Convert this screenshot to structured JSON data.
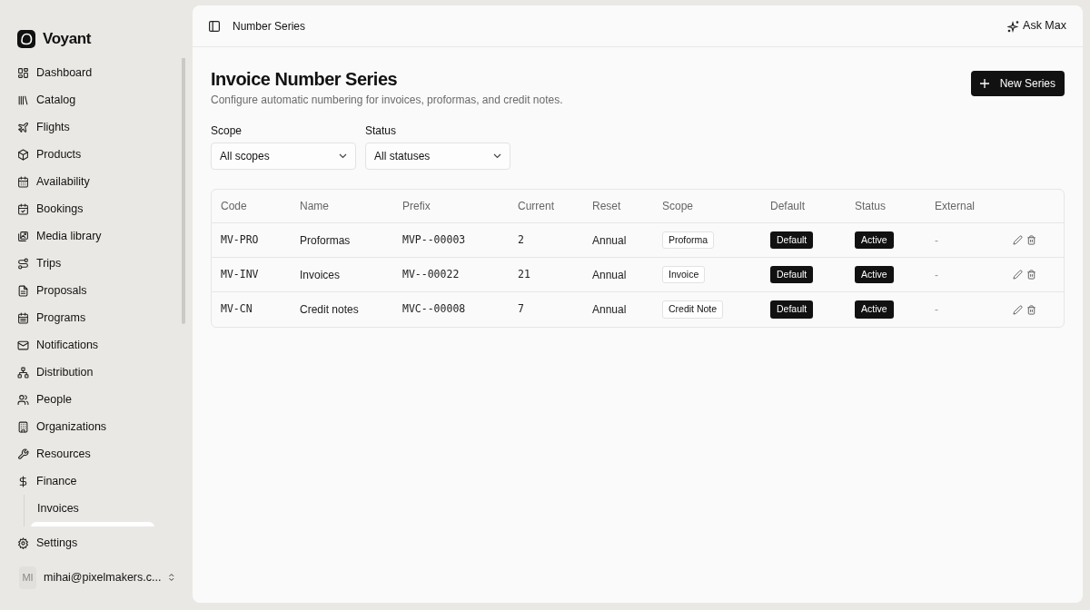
{
  "brand": "Voyant",
  "sidebar": {
    "items": [
      {
        "label": "Dashboard",
        "selected": false
      },
      {
        "label": "Catalog",
        "selected": false
      },
      {
        "label": "Flights",
        "selected": false
      },
      {
        "label": "Products",
        "selected": false
      },
      {
        "label": "Availability",
        "selected": false
      },
      {
        "label": "Bookings",
        "selected": false
      },
      {
        "label": "Media library",
        "selected": false
      },
      {
        "label": "Trips",
        "selected": false
      },
      {
        "label": "Proposals",
        "selected": false
      },
      {
        "label": "Programs",
        "selected": false
      },
      {
        "label": "Notifications",
        "selected": false
      },
      {
        "label": "Distribution",
        "selected": false
      },
      {
        "label": "People",
        "selected": false
      },
      {
        "label": "Organizations",
        "selected": false
      },
      {
        "label": "Resources",
        "selected": false
      },
      {
        "label": "Finance",
        "selected": false,
        "expanded": true,
        "children": [
          {
            "label": "Invoices",
            "selected": false
          }
        ]
      }
    ],
    "settings": "Settings",
    "user": {
      "initials": "MI",
      "email": "mihai@pixelmakers.c..."
    }
  },
  "header": {
    "breadcrumb": "Number Series",
    "ask": "Ask Max"
  },
  "page": {
    "title": "Invoice Number Series",
    "subtitle": "Configure automatic numbering for invoices, proformas, and credit notes.",
    "new_button": "New Series"
  },
  "filters": [
    {
      "label": "Scope",
      "value": "All scopes"
    },
    {
      "label": "Status",
      "value": "All statuses"
    }
  ],
  "table": {
    "columns": [
      "Code",
      "Name",
      "Prefix",
      "Current",
      "Reset",
      "Scope",
      "Default",
      "Status",
      "External"
    ],
    "rows": [
      {
        "code": "MV-PRO",
        "name": "Proformas",
        "prefix": "MVP--00003",
        "current": "2",
        "reset": "Annual",
        "scope": "Proforma",
        "default": "Default",
        "status": "Active",
        "external": "-"
      },
      {
        "code": "MV-INV",
        "name": "Invoices",
        "prefix": "MV--00022",
        "current": "21",
        "reset": "Annual",
        "scope": "Invoice",
        "default": "Default",
        "status": "Active",
        "external": "-"
      },
      {
        "code": "MV-CN",
        "name": "Credit notes",
        "prefix": "MVC--00008",
        "current": "7",
        "reset": "Annual",
        "scope": "Credit Note",
        "default": "Default",
        "status": "Active",
        "external": "-"
      }
    ]
  }
}
